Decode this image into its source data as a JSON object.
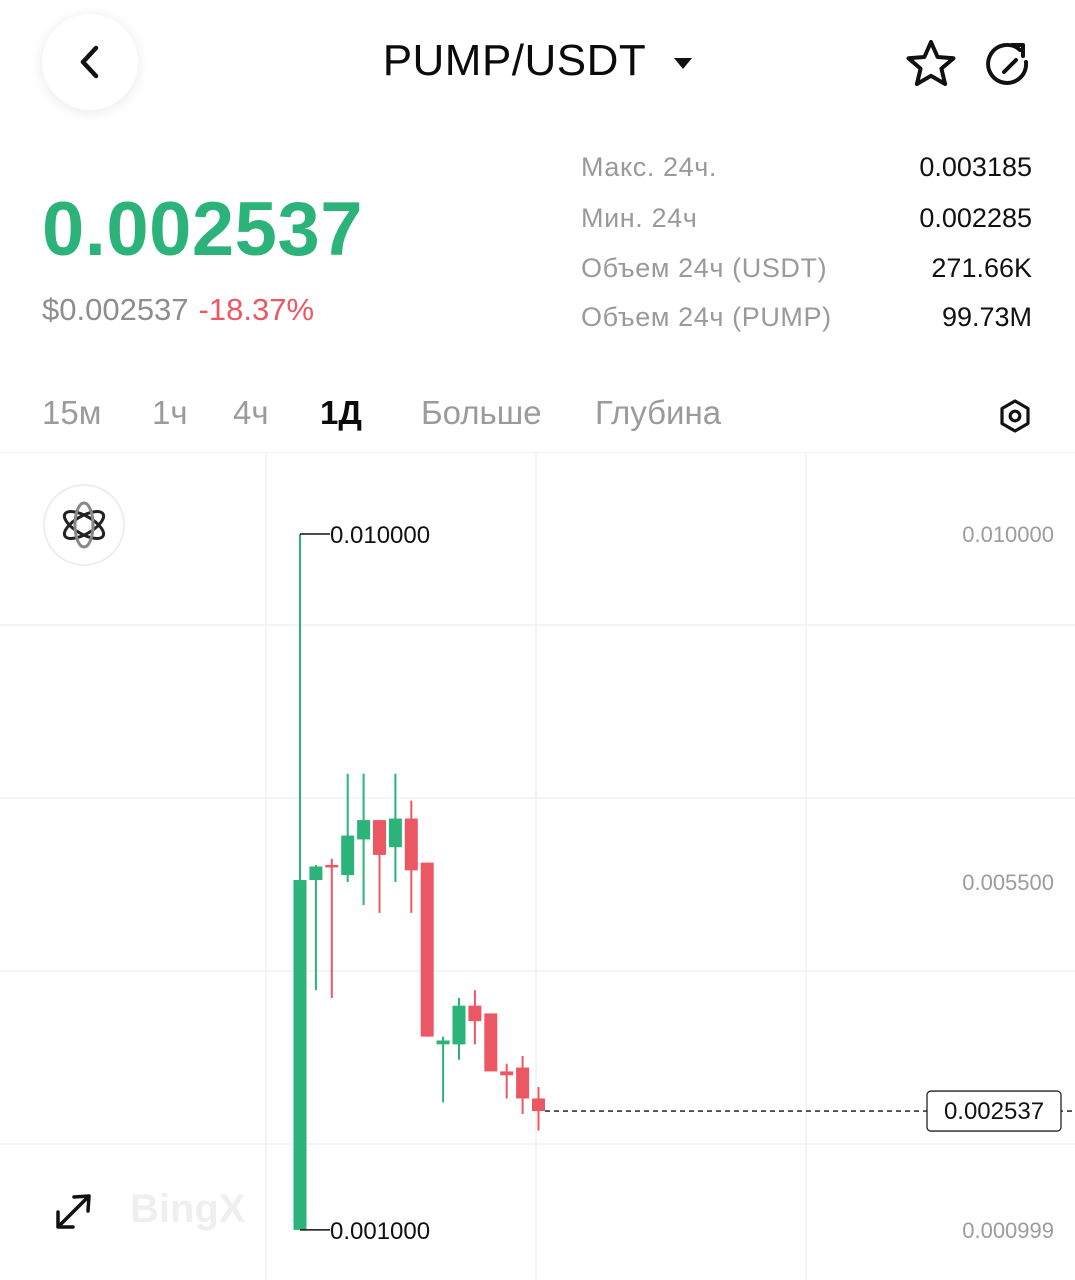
{
  "header": {
    "pair": "PUMP/USDT",
    "back_icon": "chevron-left-icon",
    "dropdown_icon": "caret-down-icon",
    "favorite_icon": "star-icon",
    "share_icon": "refresh-share-icon"
  },
  "ticker": {
    "last_price": "0.002537",
    "usd_price": "$0.002537",
    "change": "-18.37%",
    "up_color": "#2bb37a",
    "down_color": "#ec5764"
  },
  "stats": [
    {
      "label": "Макс. 24ч.",
      "value": "0.003185"
    },
    {
      "label": "Мин. 24ч",
      "value": "0.002285"
    },
    {
      "label": "Объем 24ч (USDT)",
      "value": "271.66K"
    },
    {
      "label": "Объем 24ч (PUMP)",
      "value": "99.73M"
    }
  ],
  "tabs": [
    {
      "label": "15м",
      "active": false
    },
    {
      "label": "1ч",
      "active": false
    },
    {
      "label": "4ч",
      "active": false
    },
    {
      "label": "1Д",
      "active": true
    },
    {
      "label": "Больше",
      "active": false
    },
    {
      "label": "Глубина",
      "active": false
    }
  ],
  "settings_icon": "hexagon-settings-icon",
  "indicator_icon": "atom-indicator-icon",
  "expand_icon": "expand-arrows-icon",
  "chart_data": {
    "type": "candlestick",
    "y_axis_labels": [
      "0.010000",
      "0.005500",
      "0.000999"
    ],
    "high_marker": "0.010000",
    "low_marker": "0.001000",
    "last_price_label": "0.002537",
    "watermark": "BingX",
    "ylim": [
      0.000999,
      0.01
    ],
    "candles": [
      {
        "o": 0.001,
        "h": 0.01,
        "l": 0.001,
        "c": 0.005525
      },
      {
        "o": 0.005525,
        "h": 0.00572,
        "l": 0.0041,
        "c": 0.0057
      },
      {
        "o": 0.00572,
        "h": 0.0058,
        "l": 0.004,
        "c": 0.00569
      },
      {
        "o": 0.00559,
        "h": 0.0069,
        "l": 0.0055,
        "c": 0.0061
      },
      {
        "o": 0.00605,
        "h": 0.0069,
        "l": 0.0052,
        "c": 0.0063
      },
      {
        "o": 0.0063,
        "h": 0.0062,
        "l": 0.0051,
        "c": 0.00585
      },
      {
        "o": 0.00595,
        "h": 0.0069,
        "l": 0.0055,
        "c": 0.00632
      },
      {
        "o": 0.00632,
        "h": 0.00655,
        "l": 0.0051,
        "c": 0.00565
      },
      {
        "o": 0.00575,
        "h": 0.00575,
        "l": 0.0035,
        "c": 0.0035
      },
      {
        "o": 0.0034,
        "h": 0.0035,
        "l": 0.00265,
        "c": 0.00345
      },
      {
        "o": 0.0034,
        "h": 0.004,
        "l": 0.0032,
        "c": 0.0039
      },
      {
        "o": 0.0039,
        "h": 0.0041,
        "l": 0.0034,
        "c": 0.0037
      },
      {
        "o": 0.0038,
        "h": 0.0037,
        "l": 0.0031,
        "c": 0.00305
      },
      {
        "o": 0.00305,
        "h": 0.00315,
        "l": 0.0027,
        "c": 0.003
      },
      {
        "o": 0.0031,
        "h": 0.00325,
        "l": 0.0025,
        "c": 0.0027
      },
      {
        "o": 0.0027,
        "h": 0.00285,
        "l": 0.002285,
        "c": 0.002537
      }
    ]
  }
}
